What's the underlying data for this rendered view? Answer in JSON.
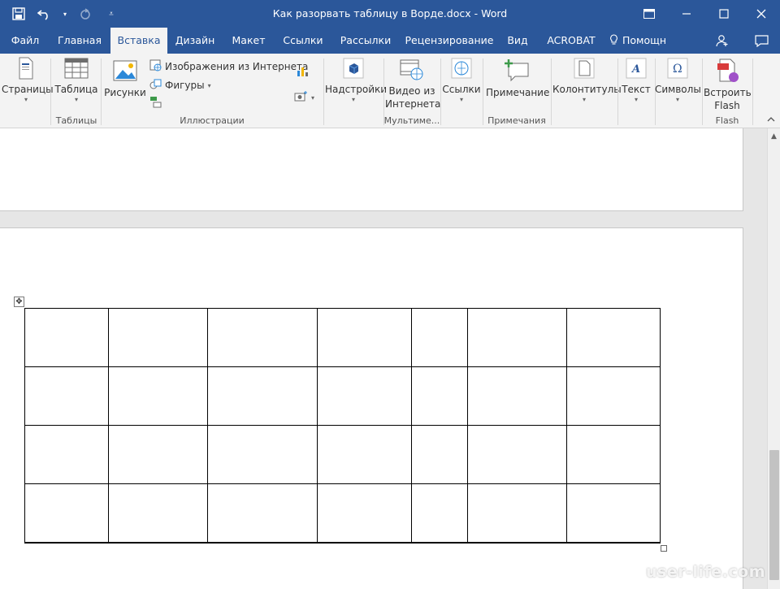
{
  "window": {
    "title": "Как разорвать таблицу в Ворде.docx - Word",
    "controls": [
      "restore-ribbon",
      "minimize",
      "maximize",
      "close"
    ]
  },
  "qat": {
    "save": "save-icon",
    "undo": "undo-icon",
    "redo": "redo-icon",
    "customize": "customize-icon"
  },
  "tabs": [
    {
      "label": "Файл"
    },
    {
      "label": "Главная"
    },
    {
      "label": "Вставка",
      "active": true
    },
    {
      "label": "Дизайн"
    },
    {
      "label": "Макет"
    },
    {
      "label": "Ссылки"
    },
    {
      "label": "Рассылки"
    },
    {
      "label": "Рецензирование"
    },
    {
      "label": "Вид"
    },
    {
      "label": "ACROBAT"
    }
  ],
  "tell_me": "Помощн",
  "ribbon": {
    "pages": "Страницы",
    "table": "Таблица",
    "group_tables": "Таблицы",
    "pictures": "Рисунки",
    "online_pictures": "Изображения из Интернета",
    "shapes": "Фигуры",
    "group_illustrations": "Иллюстрации",
    "addins": "Надстройки",
    "online_video_line1": "Видео из",
    "online_video_line2": "Интернета",
    "group_media": "Мультиме...",
    "links": "Ссылки",
    "comment": "Примечание",
    "group_comments": "Примечания",
    "header_footer": "Колонтитулы",
    "text": "Текст",
    "symbols": "Символы",
    "embed_flash_line1": "Встроить",
    "embed_flash_line2": "Flash",
    "group_flash": "Flash"
  },
  "colors": {
    "accent": "#2b579a",
    "ribbon_bg": "#f3f3f3",
    "doc_bg": "#e6e6e6"
  },
  "table": {
    "rows": 4,
    "columns": 7
  },
  "watermark": "user-life.com"
}
